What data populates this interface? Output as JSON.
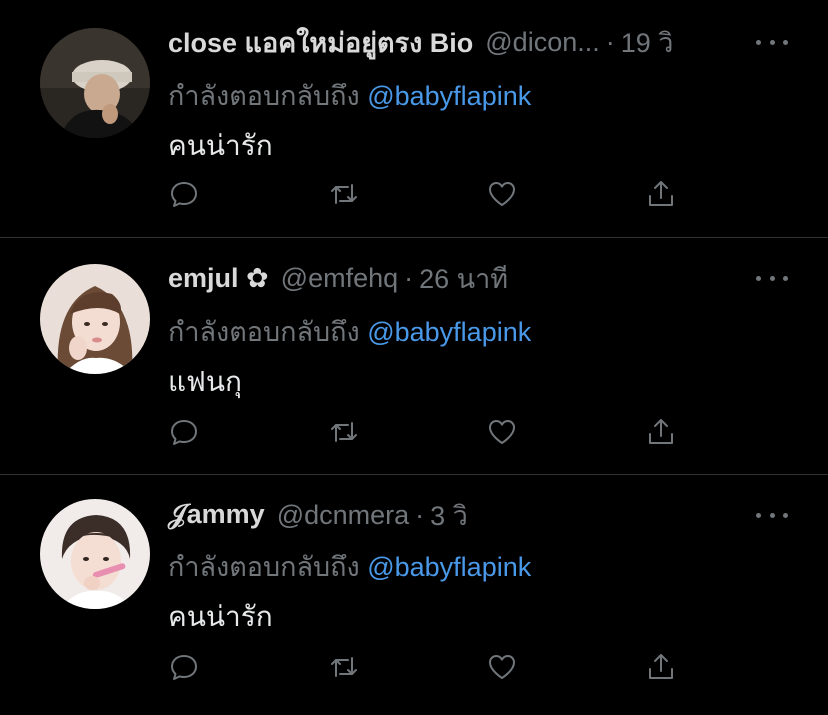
{
  "tweets": [
    {
      "display_name": "close แอคใหม่อยู่ตรง Bio",
      "handle": "@dicon...",
      "separator": "·",
      "time": "19 วิ",
      "reply_prefix": "กำลังตอบกลับถึง",
      "reply_to": "@babyflapink",
      "text": "คนน่ารัก",
      "avatar_icon": "person-avatar-cap"
    },
    {
      "display_name": "emjul ✿",
      "handle": "@emfehq",
      "separator": "·",
      "time": "26 นาที",
      "reply_prefix": "กำลังตอบกลับถึง",
      "reply_to": "@babyflapink",
      "text": "แฟนกุ",
      "avatar_icon": "person-avatar-girl"
    },
    {
      "display_name": "𝒥ammy",
      "handle": "@dcnmera",
      "separator": "·",
      "time": "3 วิ",
      "reply_prefix": "กำลังตอบกลับถึง",
      "reply_to": "@babyflapink",
      "text": "คนน่ารัก",
      "avatar_icon": "person-avatar-boy"
    }
  ],
  "icons": {
    "reply": "reply-icon",
    "retweet": "retweet-icon",
    "like": "like-icon",
    "share": "share-icon",
    "more": "more-icon"
  },
  "colors": {
    "background": "#000000",
    "text": "#e7e9ea",
    "muted": "#71767b",
    "mention": "#4a99e9",
    "divider": "#2f3336"
  }
}
